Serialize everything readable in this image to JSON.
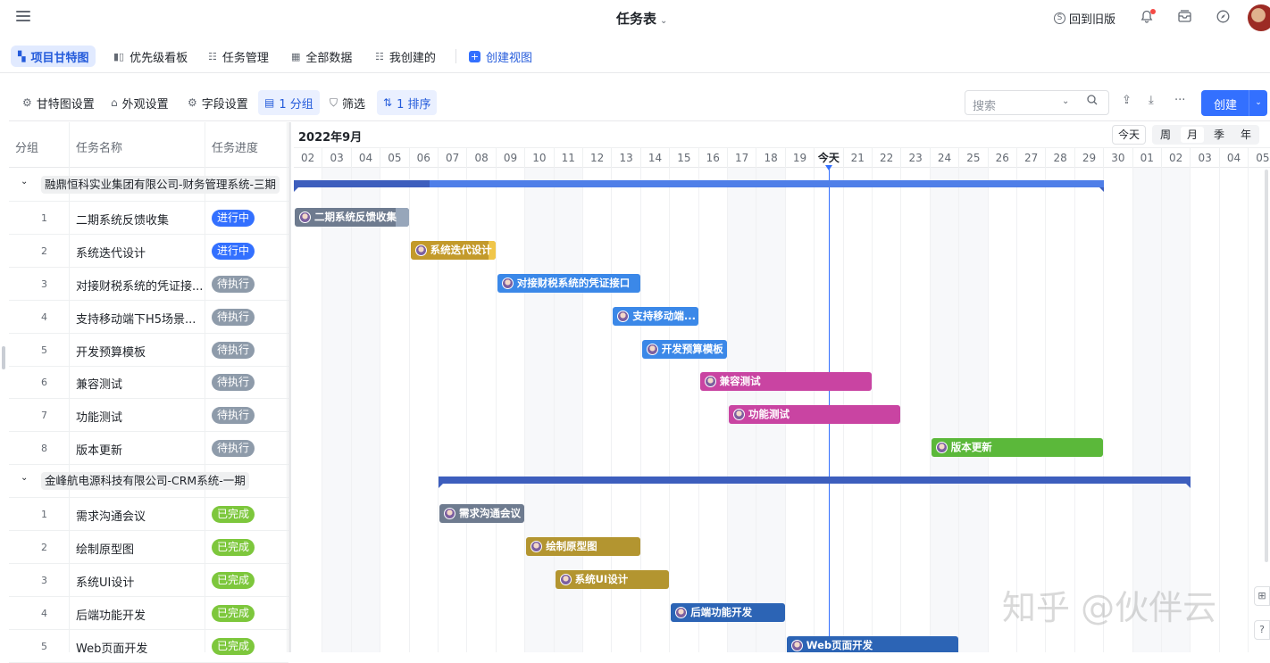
{
  "topbar": {
    "title": "任务表",
    "old_version": "回到旧版",
    "icons": [
      "menu-icon",
      "old-version-icon",
      "bell-icon",
      "inbox-icon",
      "compass-icon",
      "avatar"
    ]
  },
  "views": [
    {
      "label": "项目甘特图",
      "icon": "gantt-view-icon",
      "active": true
    },
    {
      "label": "优先级看板",
      "icon": "kanban-view-icon",
      "active": false
    },
    {
      "label": "任务管理",
      "icon": "grid-view-icon",
      "active": false
    },
    {
      "label": "全部数据",
      "icon": "gallery-view-icon",
      "active": false
    },
    {
      "label": "我创建的",
      "icon": "grid-view-icon",
      "active": false
    },
    {
      "label": "创建视图",
      "icon": "plus-icon",
      "active": false
    }
  ],
  "toolbar": {
    "gantt_settings": "甘特图设置",
    "appearance": "外观设置",
    "fields": "字段设置",
    "group": "1 分组",
    "filter": "筛选",
    "sort": "1 排序",
    "search_placeholder": "搜索",
    "create": "创建"
  },
  "table": {
    "headers": {
      "group": "分组",
      "name": "任务名称",
      "progress": "任务进度"
    },
    "groups": [
      {
        "name": "融鼎恒科实业集团有限公司-财务管理系统-三期",
        "rows": [
          {
            "num": "1",
            "name": "二期系统反馈收集",
            "status": "进行中"
          },
          {
            "num": "2",
            "name": "系统迭代设计",
            "status": "进行中"
          },
          {
            "num": "3",
            "name": "对接财税系统的凭证接...",
            "status": "待执行"
          },
          {
            "num": "4",
            "name": "支持移动端下H5场景...",
            "status": "待执行"
          },
          {
            "num": "5",
            "name": "开发预算模板",
            "status": "待执行"
          },
          {
            "num": "6",
            "name": "兼容测试",
            "status": "待执行"
          },
          {
            "num": "7",
            "name": "功能测试",
            "status": "待执行"
          },
          {
            "num": "8",
            "name": "版本更新",
            "status": "待执行"
          }
        ]
      },
      {
        "name": "金峰航电源科技有限公司-CRM系统-一期",
        "rows": [
          {
            "num": "1",
            "name": "需求沟通会议",
            "status": "已完成"
          },
          {
            "num": "2",
            "name": "绘制原型图",
            "status": "已完成"
          },
          {
            "num": "3",
            "name": "系统UI设计",
            "status": "已完成"
          },
          {
            "num": "4",
            "name": "后端功能开发",
            "status": "已完成"
          },
          {
            "num": "5",
            "name": "Web页面开发",
            "status": "已完成"
          }
        ]
      }
    ],
    "status_colors": {
      "进行中": "#3370ff",
      "待执行": "#8e9baa",
      "已完成": "#7dc73c"
    }
  },
  "gantt": {
    "month": "2022年9月",
    "today_button": "今天",
    "scales": [
      "周",
      "月",
      "季",
      "年"
    ],
    "active_scale": "月",
    "days": [
      "02",
      "03",
      "04",
      "05",
      "06",
      "07",
      "08",
      "09",
      "10",
      "11",
      "12",
      "13",
      "14",
      "15",
      "16",
      "17",
      "18",
      "19",
      "今天",
      "21",
      "22",
      "23",
      "24",
      "25",
      "26",
      "27",
      "28",
      "29",
      "30",
      "01",
      "02",
      "03",
      "04",
      "05"
    ],
    "weekend_cols": [
      1,
      2,
      8,
      9,
      15,
      16,
      22,
      23,
      29,
      30
    ],
    "today_index": 18,
    "group_bars": [
      {
        "row": 0,
        "start": 0,
        "end": 28,
        "done_until": 4.7
      },
      {
        "row": 9,
        "start": 5,
        "end": 31,
        "done_until": 31
      }
    ],
    "tasks": [
      {
        "row": 1,
        "label": "二期系统反馈收集",
        "start": 0,
        "end": 4,
        "color": "#6e7b8f",
        "tail": "#97a6ba",
        "tail_from": 3.5
      },
      {
        "row": 2,
        "label": "系统迭代设计",
        "start": 4,
        "end": 7,
        "color": "#c39a2b",
        "tail": "#f0c64a",
        "tail_from": 2.7
      },
      {
        "row": 3,
        "label": "对接财税系统的凭证接口",
        "start": 7,
        "end": 12,
        "color": "#3b88e8"
      },
      {
        "row": 4,
        "label": "支持移动端...",
        "start": 11,
        "end": 14,
        "color": "#3b88e8"
      },
      {
        "row": 5,
        "label": "开发预算模板",
        "start": 12,
        "end": 15,
        "color": "#3b88e8"
      },
      {
        "row": 6,
        "label": "兼容测试",
        "start": 14,
        "end": 20,
        "color": "#c944a2"
      },
      {
        "row": 7,
        "label": "功能测试",
        "start": 15,
        "end": 21,
        "color": "#c944a2"
      },
      {
        "row": 8,
        "label": "版本更新",
        "start": 22,
        "end": 28,
        "color": "#5bb83a"
      },
      {
        "row": 10,
        "label": "需求沟通会议",
        "start": 5,
        "end": 8,
        "color": "#6e7b8f"
      },
      {
        "row": 11,
        "label": "绘制原型图",
        "start": 8,
        "end": 12,
        "color": "#b39530"
      },
      {
        "row": 12,
        "label": "系统UI设计",
        "start": 9,
        "end": 13,
        "color": "#b39530"
      },
      {
        "row": 13,
        "label": "后端功能开发",
        "start": 13,
        "end": 17,
        "color": "#2c64b5"
      },
      {
        "row": 14,
        "label": "Web页面开发",
        "start": 17,
        "end": 23,
        "color": "#2c64b5"
      }
    ]
  },
  "watermark": "知乎 @伙伴云"
}
